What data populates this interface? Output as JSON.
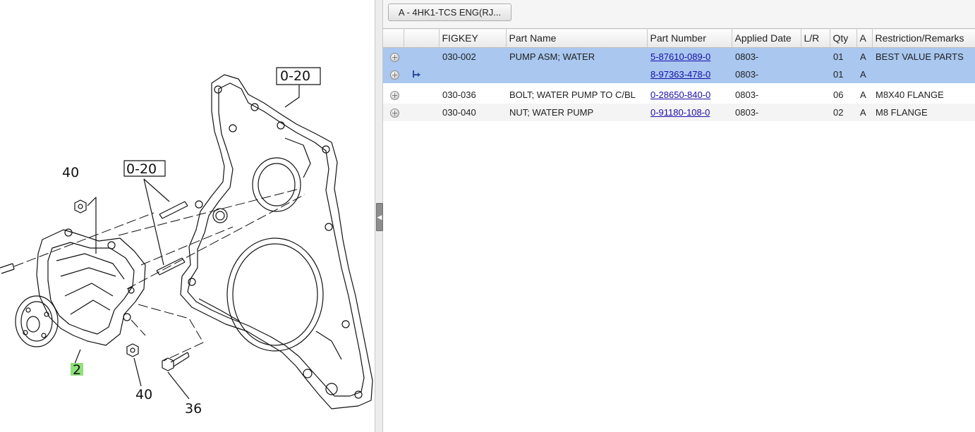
{
  "diagram": {
    "callouts": {
      "ref_top": "0-20",
      "ref_mid": "0-20",
      "part_40_top": "40",
      "part_2": "2",
      "part_40_bottom": "40",
      "part_36": "36"
    },
    "highlight_color": "#8ee07a"
  },
  "toolbar": {
    "engine_label": "A - 4HK1-TCS ENG(RJ..."
  },
  "table": {
    "columns": [
      "",
      "",
      "FIGKEY",
      "Part Name",
      "Part Number",
      "Applied Date",
      "L/R",
      "Qty",
      "A",
      "Restriction/Remarks"
    ],
    "rows": [
      {
        "icon": "expand-icon",
        "sub": false,
        "figkey": "030-002",
        "part_name": "PUMP ASM; WATER",
        "part_number": "5-87610-089-0",
        "applied_date": "0803-",
        "lr": "",
        "qty": "01",
        "a": "A",
        "remarks": "BEST VALUE PARTS",
        "state": "selected"
      },
      {
        "icon": "expand-icon",
        "sub": true,
        "figkey": "",
        "part_name": "",
        "part_number": "8-97363-478-0",
        "applied_date": "0803-",
        "lr": "",
        "qty": "01",
        "a": "A",
        "remarks": "",
        "state": "selected"
      },
      {
        "icon": "expand-icon",
        "sub": false,
        "figkey": "030-036",
        "part_name": "BOLT; WATER PUMP TO C/BL",
        "part_number": "0-28650-840-0",
        "applied_date": "0803-",
        "lr": "",
        "qty": "06",
        "a": "A",
        "remarks": "M8X40 FLANGE",
        "state": "normal"
      },
      {
        "icon": "expand-icon",
        "sub": false,
        "figkey": "030-040",
        "part_name": "NUT; WATER PUMP",
        "part_number": "0-91180-108-0",
        "applied_date": "0803-",
        "lr": "",
        "qty": "02",
        "a": "A",
        "remarks": "M8 FLANGE",
        "state": "striped"
      }
    ]
  }
}
